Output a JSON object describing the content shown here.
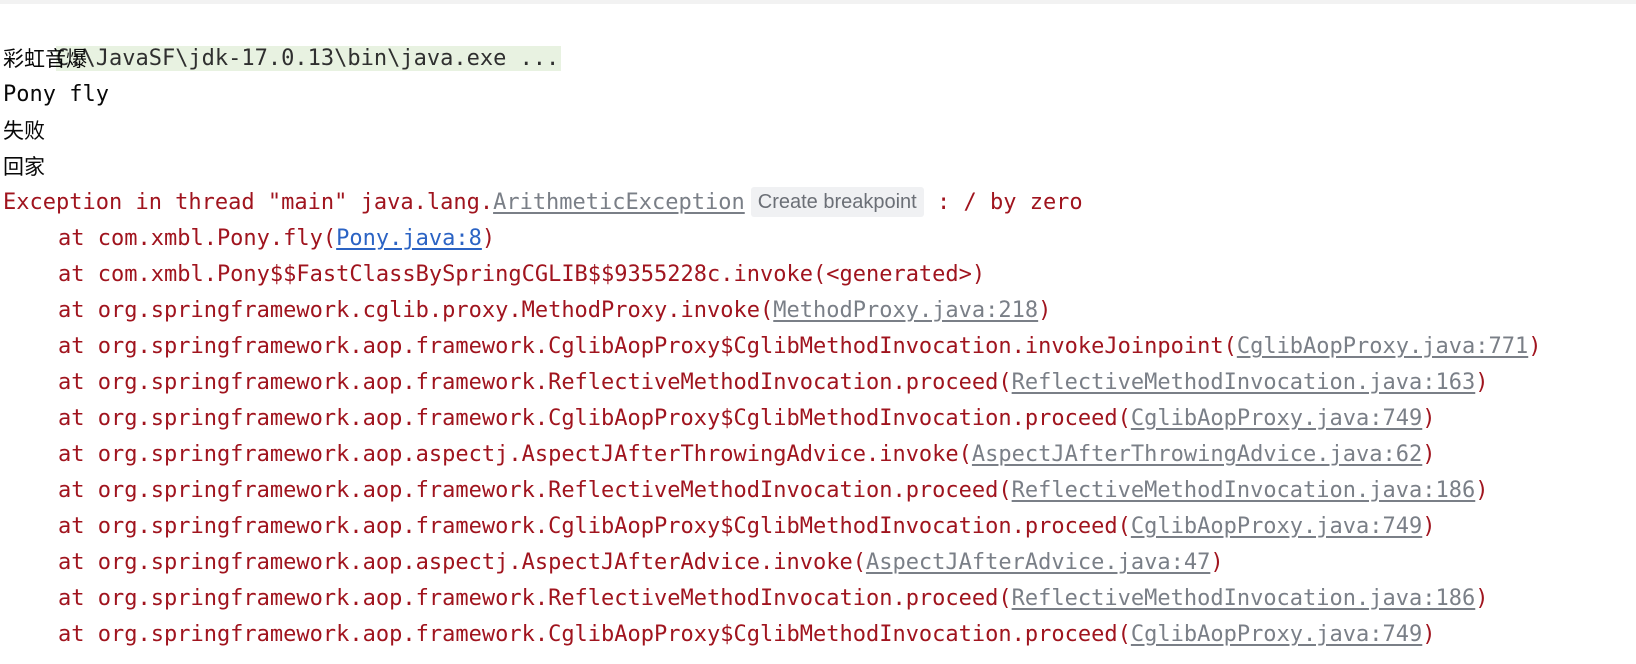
{
  "console": {
    "command": "C:\\JavaSF\\jdk-17.0.13\\bin\\java.exe ...",
    "output_lines": [
      "彩虹音爆",
      "Pony fly",
      "失败",
      "回家"
    ],
    "exception": {
      "prefix": "Exception in thread \"main\" java.lang.",
      "class_name": "ArithmeticException",
      "breakpoint_label": "Create breakpoint",
      "message": " : / by zero"
    },
    "frames": [
      {
        "method": "at com.xmbl.Pony.fly(",
        "link": "Pony.java:8",
        "suffix": ")"
      },
      {
        "method": "at com.xmbl.Pony$$FastClassBySpringCGLIB$$9355228c.invoke(<generated>)",
        "link": "",
        "suffix": ""
      },
      {
        "method": "at org.springframework.cglib.proxy.MethodProxy.invoke(",
        "link": "MethodProxy.java:218",
        "suffix": ")"
      },
      {
        "method": "at org.springframework.aop.framework.CglibAopProxy$CglibMethodInvocation.invokeJoinpoint(",
        "link": "CglibAopProxy.java:771",
        "suffix": ")"
      },
      {
        "method": "at org.springframework.aop.framework.ReflectiveMethodInvocation.proceed(",
        "link": "ReflectiveMethodInvocation.java:163",
        "suffix": ")"
      },
      {
        "method": "at org.springframework.aop.framework.CglibAopProxy$CglibMethodInvocation.proceed(",
        "link": "CglibAopProxy.java:749",
        "suffix": ")"
      },
      {
        "method": "at org.springframework.aop.aspectj.AspectJAfterThrowingAdvice.invoke(",
        "link": "AspectJAfterThrowingAdvice.java:62",
        "suffix": ")"
      },
      {
        "method": "at org.springframework.aop.framework.ReflectiveMethodInvocation.proceed(",
        "link": "ReflectiveMethodInvocation.java:186",
        "suffix": ")"
      },
      {
        "method": "at org.springframework.aop.framework.CglibAopProxy$CglibMethodInvocation.proceed(",
        "link": "CglibAopProxy.java:749",
        "suffix": ")"
      },
      {
        "method": "at org.springframework.aop.aspectj.AspectJAfterAdvice.invoke(",
        "link": "AspectJAfterAdvice.java:47",
        "suffix": ")"
      },
      {
        "method": "at org.springframework.aop.framework.ReflectiveMethodInvocation.proceed(",
        "link": "ReflectiveMethodInvocation.java:186",
        "suffix": ")"
      },
      {
        "method": "at org.springframework.aop.framework.CglibAopProxy$CglibMethodInvocation.proceed(",
        "link": "CglibAopProxy.java:749",
        "suffix": ")"
      }
    ]
  },
  "colors": {
    "error_text": "#a0141e",
    "link_visited": "#7a7f87",
    "link_active": "#2b63c4",
    "command_bg": "#e8f2e1"
  }
}
